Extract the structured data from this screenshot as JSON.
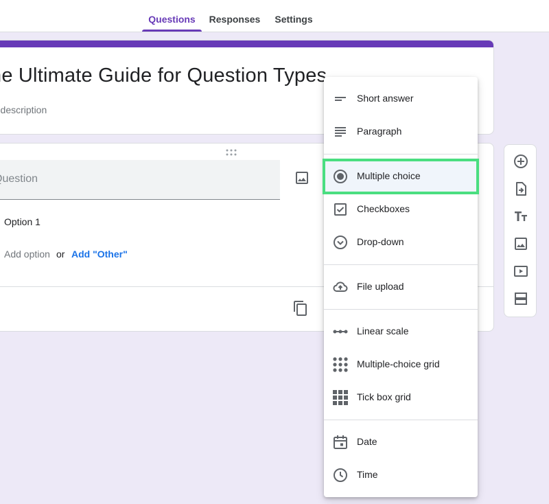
{
  "tabs": [
    {
      "label": "Questions",
      "active": true
    },
    {
      "label": "Responses"
    },
    {
      "label": "Settings"
    }
  ],
  "form": {
    "title": "he Ultimate Guide for Question Types",
    "description": "m description"
  },
  "question": {
    "placeholder": "Question",
    "option_label": "Option 1",
    "add_option": "Add option",
    "or": "or",
    "add_other": "Add \"Other\""
  },
  "menu": {
    "items": [
      {
        "label": "Short answer",
        "icon": "short-answer-icon"
      },
      {
        "label": "Paragraph",
        "icon": "paragraph-icon"
      },
      {
        "label": "Multiple choice",
        "icon": "radio-button-icon",
        "selected": true
      },
      {
        "label": "Checkboxes",
        "icon": "checkbox-icon"
      },
      {
        "label": "Drop-down",
        "icon": "dropdown-circle-icon"
      },
      {
        "label": "File upload",
        "icon": "cloud-upload-icon"
      },
      {
        "label": "Linear scale",
        "icon": "linear-scale-icon"
      },
      {
        "label": "Multiple-choice grid",
        "icon": "dot-grid-icon"
      },
      {
        "label": "Tick box grid",
        "icon": "square-grid-icon"
      },
      {
        "label": "Date",
        "icon": "calendar-icon"
      },
      {
        "label": "Time",
        "icon": "clock-icon"
      }
    ]
  },
  "colors": {
    "accent": "#673ab7",
    "link": "#1a73e8",
    "highlight": "#4ade80",
    "background": "#ede9f7"
  }
}
